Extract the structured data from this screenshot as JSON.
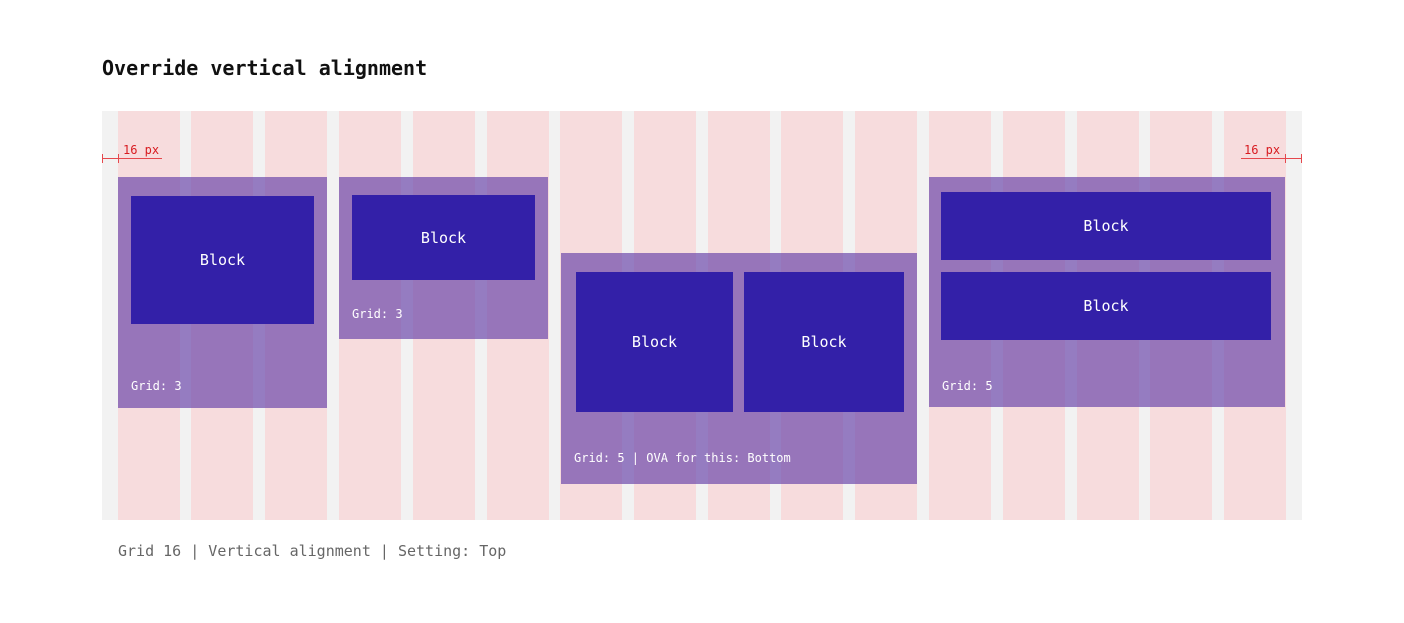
{
  "title": "Override vertical alignment",
  "measure_left": "16 px",
  "measure_right": "16 px",
  "groups": [
    {
      "label": "Grid: 3",
      "blocks": [
        "Block"
      ]
    },
    {
      "label": "Grid: 3",
      "blocks": [
        "Block"
      ]
    },
    {
      "label": "Grid: 5 | OVA for this: Bottom",
      "blocks": [
        "Block",
        "Block"
      ]
    },
    {
      "label": "Grid: 5",
      "blocks": [
        "Block",
        "Block"
      ]
    }
  ],
  "caption": "Grid 16 | Vertical alignment | Setting: Top",
  "colors": {
    "column": "#f7dcdd",
    "gutter": "#f2f2f2",
    "group": "#9580c4",
    "block": "#3320a8",
    "measure": "#e5484d"
  }
}
